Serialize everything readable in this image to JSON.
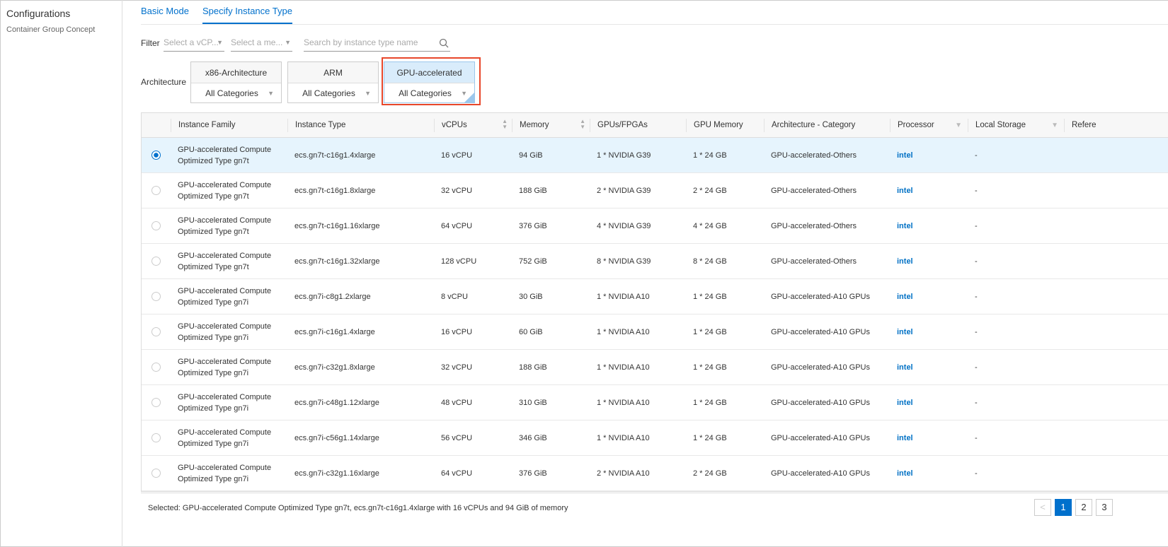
{
  "sidebar": {
    "title": "Configurations",
    "subtitle": "Container Group Concept"
  },
  "tabs": [
    {
      "label": "Basic Mode"
    },
    {
      "label": "Specify Instance Type"
    }
  ],
  "filter": {
    "label": "Filter",
    "vcpu_placeholder": "Select a vCP...",
    "memory_placeholder": "Select a me...",
    "search_placeholder": "Search by instance type name"
  },
  "architecture": {
    "label": "Architecture",
    "options": [
      {
        "name": "x86-Architecture",
        "category": "All Categories"
      },
      {
        "name": "ARM",
        "category": "All Categories"
      },
      {
        "name": "GPU-accelerated",
        "category": "All Categories",
        "selected": true
      }
    ]
  },
  "table": {
    "columns": [
      "Instance Family",
      "Instance Type",
      "vCPUs",
      "Memory",
      "GPUs/FPGAs",
      "GPU Memory",
      "Architecture - Category",
      "Processor",
      "Local Storage",
      "Refere"
    ],
    "rows": [
      {
        "family": "GPU-accelerated Compute Optimized Type gn7t",
        "type": "ecs.gn7t-c16g1.4xlarge",
        "vcpus": "16 vCPU",
        "memory": "94 GiB",
        "gpus": "1 * NVIDIA G39",
        "gpu_memory": "1 * 24 GB",
        "category": "GPU-accelerated-Others",
        "processor": "intel",
        "storage": "-",
        "selected": true
      },
      {
        "family": "GPU-accelerated Compute Optimized Type gn7t",
        "type": "ecs.gn7t-c16g1.8xlarge",
        "vcpus": "32 vCPU",
        "memory": "188 GiB",
        "gpus": "2 * NVIDIA G39",
        "gpu_memory": "2 * 24 GB",
        "category": "GPU-accelerated-Others",
        "processor": "intel",
        "storage": "-"
      },
      {
        "family": "GPU-accelerated Compute Optimized Type gn7t",
        "type": "ecs.gn7t-c16g1.16xlarge",
        "vcpus": "64 vCPU",
        "memory": "376 GiB",
        "gpus": "4 * NVIDIA G39",
        "gpu_memory": "4 * 24 GB",
        "category": "GPU-accelerated-Others",
        "processor": "intel",
        "storage": "-"
      },
      {
        "family": "GPU-accelerated Compute Optimized Type gn7t",
        "type": "ecs.gn7t-c16g1.32xlarge",
        "vcpus": "128 vCPU",
        "memory": "752 GiB",
        "gpus": "8 * NVIDIA G39",
        "gpu_memory": "8 * 24 GB",
        "category": "GPU-accelerated-Others",
        "processor": "intel",
        "storage": "-"
      },
      {
        "family": "GPU-accelerated Compute Optimized Type gn7i",
        "type": "ecs.gn7i-c8g1.2xlarge",
        "vcpus": "8 vCPU",
        "memory": "30 GiB",
        "gpus": "1 * NVIDIA A10",
        "gpu_memory": "1 * 24 GB",
        "category": "GPU-accelerated-A10 GPUs",
        "processor": "intel",
        "storage": "-"
      },
      {
        "family": "GPU-accelerated Compute Optimized Type gn7i",
        "type": "ecs.gn7i-c16g1.4xlarge",
        "vcpus": "16 vCPU",
        "memory": "60 GiB",
        "gpus": "1 * NVIDIA A10",
        "gpu_memory": "1 * 24 GB",
        "category": "GPU-accelerated-A10 GPUs",
        "processor": "intel",
        "storage": "-"
      },
      {
        "family": "GPU-accelerated Compute Optimized Type gn7i",
        "type": "ecs.gn7i-c32g1.8xlarge",
        "vcpus": "32 vCPU",
        "memory": "188 GiB",
        "gpus": "1 * NVIDIA A10",
        "gpu_memory": "1 * 24 GB",
        "category": "GPU-accelerated-A10 GPUs",
        "processor": "intel",
        "storage": "-"
      },
      {
        "family": "GPU-accelerated Compute Optimized Type gn7i",
        "type": "ecs.gn7i-c48g1.12xlarge",
        "vcpus": "48 vCPU",
        "memory": "310 GiB",
        "gpus": "1 * NVIDIA A10",
        "gpu_memory": "1 * 24 GB",
        "category": "GPU-accelerated-A10 GPUs",
        "processor": "intel",
        "storage": "-"
      },
      {
        "family": "GPU-accelerated Compute Optimized Type gn7i",
        "type": "ecs.gn7i-c56g1.14xlarge",
        "vcpus": "56 vCPU",
        "memory": "346 GiB",
        "gpus": "1 * NVIDIA A10",
        "gpu_memory": "1 * 24 GB",
        "category": "GPU-accelerated-A10 GPUs",
        "processor": "intel",
        "storage": "-"
      },
      {
        "family": "GPU-accelerated Compute Optimized Type gn7i",
        "type": "ecs.gn7i-c32g1.16xlarge",
        "vcpus": "64 vCPU",
        "memory": "376 GiB",
        "gpus": "2 * NVIDIA A10",
        "gpu_memory": "2 * 24 GB",
        "category": "GPU-accelerated-A10 GPUs",
        "processor": "intel",
        "storage": "-"
      }
    ]
  },
  "footer": {
    "selected_text": "Selected: GPU-accelerated Compute Optimized Type gn7t, ecs.gn7t-c16g1.4xlarge with 16 vCPUs and 94 GiB of memory",
    "pages": [
      "1",
      "2",
      "3"
    ],
    "current_page": "1",
    "prev": "<"
  },
  "colors": {
    "accent": "#0070cc",
    "highlight": "#e8472b",
    "selected_row": "#e6f4fd",
    "intel": "#0071c5"
  }
}
